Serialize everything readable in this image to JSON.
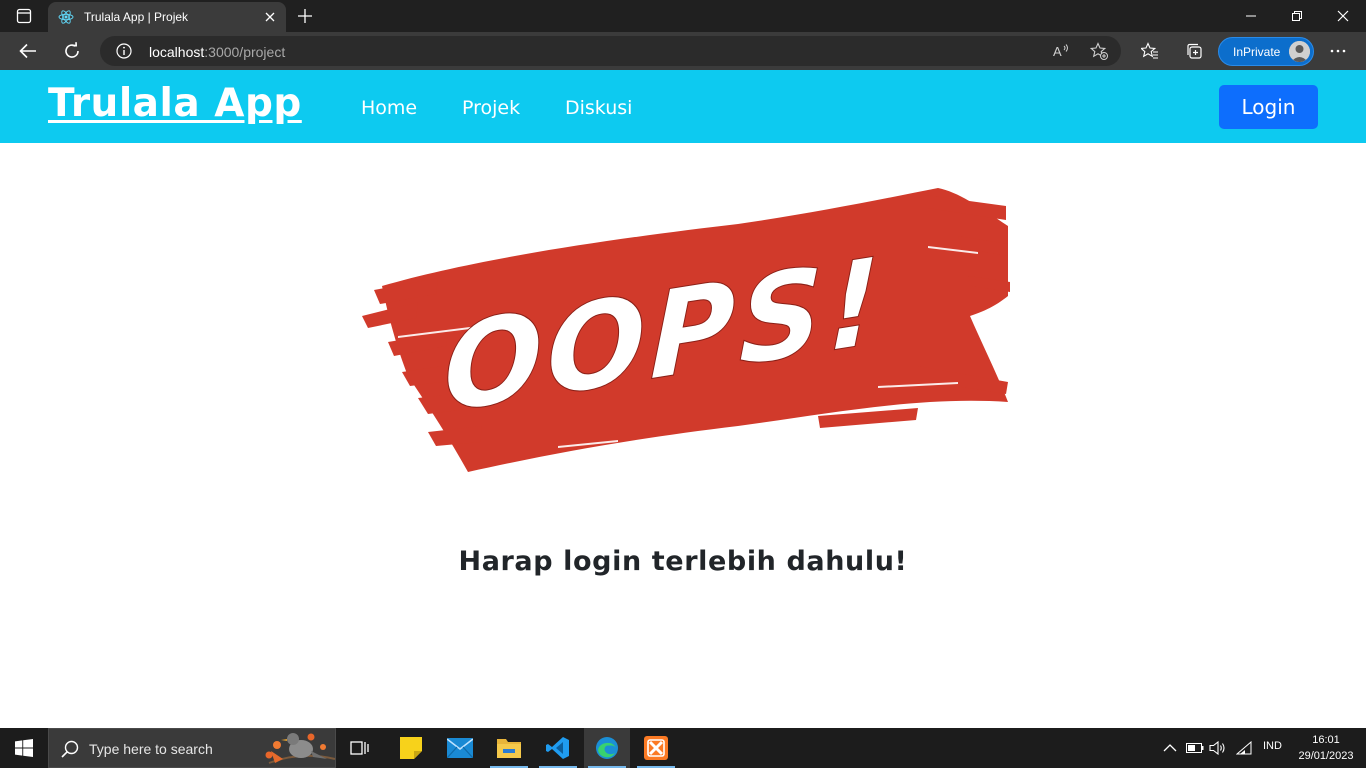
{
  "browser": {
    "tab_title": "Trulala App | Projek",
    "url_host": "localhost",
    "url_rest": ":3000/project",
    "inprivate_label": "InPrivate",
    "icons": [
      "tab-actions-icon",
      "react-favicon-icon",
      "close-icon",
      "plus-icon",
      "minimize-icon",
      "restore-icon",
      "close-window-icon",
      "back-icon",
      "refresh-icon",
      "info-icon",
      "read-aloud-icon",
      "add-favorite-icon",
      "favorites-icon",
      "collections-icon",
      "profile-avatar-icon",
      "more-icon"
    ]
  },
  "navbar": {
    "brand": "Trulala App",
    "links": [
      "Home",
      "Projek",
      "Diskusi"
    ],
    "login": "Login",
    "bg_color": "#0dcaf0",
    "button_color": "#0d6efd"
  },
  "main": {
    "oops_text": "OOPS!",
    "oops_color": "#d13a2b",
    "message": "Harap login terlebih dahulu!"
  },
  "taskbar": {
    "search_placeholder": "Type here to search",
    "apps": [
      "task-view-icon",
      "sticky-notes-icon",
      "mail-icon",
      "file-explorer-icon",
      "vscode-icon",
      "edge-icon",
      "xampp-icon"
    ],
    "language": "IND",
    "time": "16:01",
    "date": "29/01/2023"
  }
}
